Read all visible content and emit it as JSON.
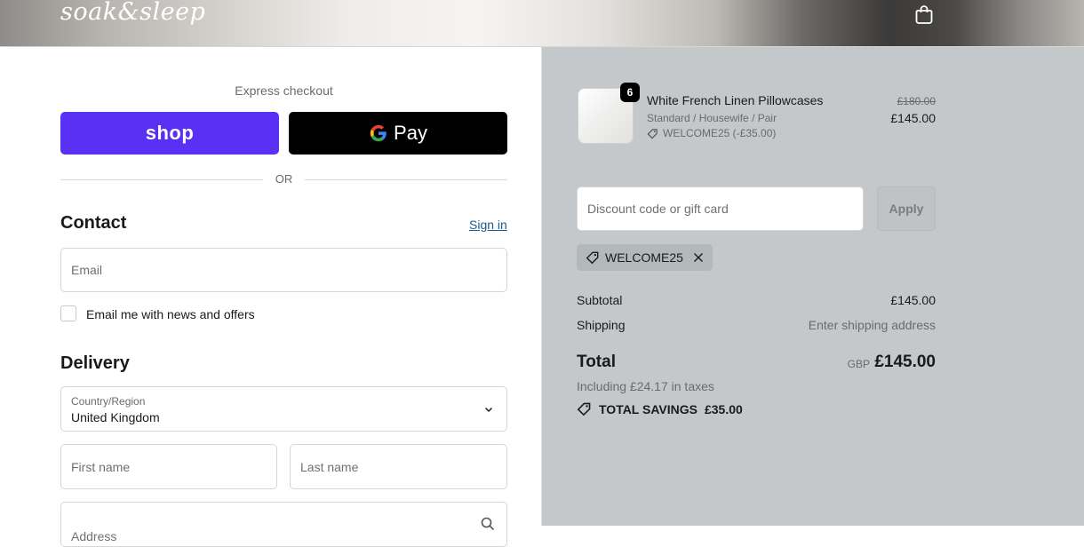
{
  "header": {
    "logo_text": "soak&sleep"
  },
  "express": {
    "title": "Express checkout",
    "shop_label": "shop",
    "gpay_label": "Pay",
    "or_label": "OR"
  },
  "contact": {
    "heading": "Contact",
    "sign_in": "Sign in",
    "email_placeholder": "Email",
    "newsletter_label": "Email me with news and offers"
  },
  "delivery": {
    "heading": "Delivery",
    "country_label": "Country/Region",
    "country_value": "United Kingdom",
    "first_name_placeholder": "First name",
    "last_name_placeholder": "Last name",
    "address_placeholder": "Address"
  },
  "summary": {
    "item": {
      "quantity": "6",
      "name": "White French Linen Pillowcases",
      "variant": "Standard / Housewife / Pair",
      "discount": "WELCOME25 (-£35.00)",
      "original_price": "£180.00",
      "price": "£145.00"
    },
    "discount_placeholder": "Discount code or gift card",
    "apply_label": "Apply",
    "applied_code": "WELCOME25",
    "subtotal_label": "Subtotal",
    "subtotal_value": "£145.00",
    "shipping_label": "Shipping",
    "shipping_value": "Enter shipping address",
    "total_label": "Total",
    "currency": "GBP",
    "total_value": "£145.00",
    "taxes_text": "Including £24.17 in taxes",
    "savings_label": "TOTAL SAVINGS",
    "savings_value": "£35.00"
  },
  "colors": {
    "shop_purple": "#5a31f4",
    "summary_bg": "#c4c8ca",
    "link_blue": "#1f5b8c"
  }
}
